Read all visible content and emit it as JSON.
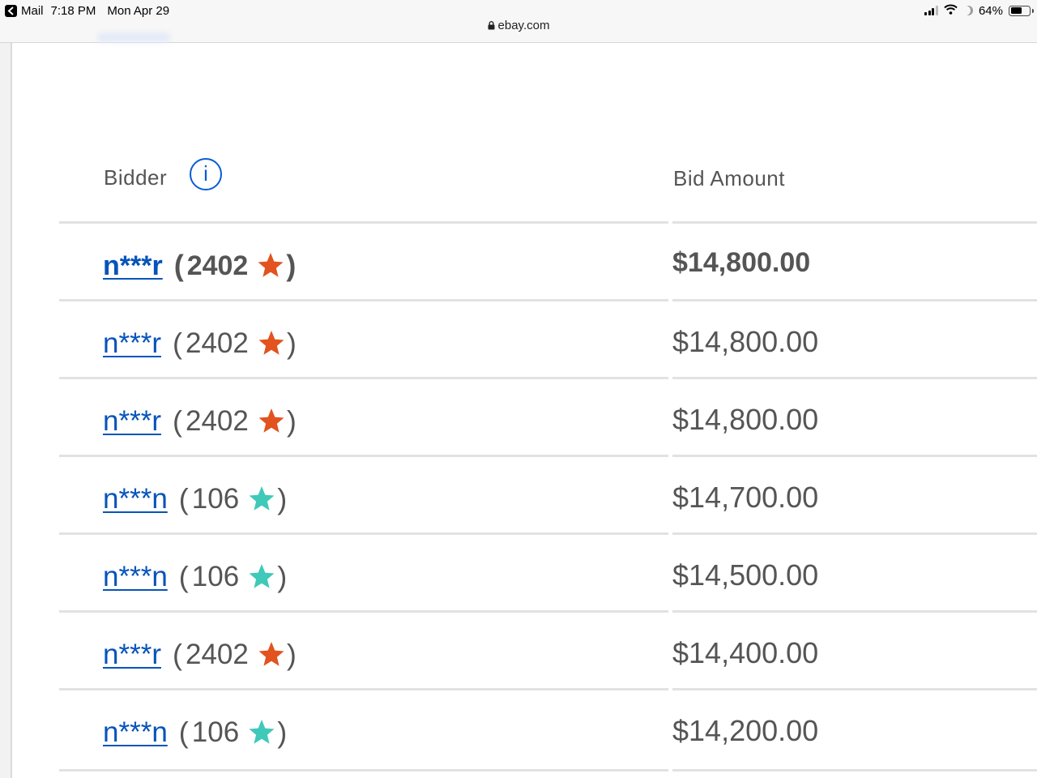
{
  "status_bar": {
    "back_app": "Mail",
    "time": "7:18 PM",
    "date": "Mon Apr 29",
    "battery": "64%",
    "battery_level": 0.64,
    "url": "ebay.com"
  },
  "table": {
    "headers": {
      "bidder": "Bidder",
      "bid_amount": "Bid Amount",
      "info_glyph": "i"
    },
    "rows": [
      {
        "name": "n***r",
        "score": "2402",
        "star_color": "#e2531f",
        "amount": "$14,800.00",
        "highlight": true
      },
      {
        "name": "n***r",
        "score": "2402",
        "star_color": "#e2531f",
        "amount": "$14,800.00",
        "highlight": false
      },
      {
        "name": "n***r",
        "score": "2402",
        "star_color": "#e2531f",
        "amount": "$14,800.00",
        "highlight": false
      },
      {
        "name": "n***n",
        "score": "106",
        "star_color": "#3fc9b8",
        "amount": "$14,700.00",
        "highlight": false
      },
      {
        "name": "n***n",
        "score": "106",
        "star_color": "#3fc9b8",
        "amount": "$14,500.00",
        "highlight": false
      },
      {
        "name": "n***r",
        "score": "2402",
        "star_color": "#e2531f",
        "amount": "$14,400.00",
        "highlight": false
      },
      {
        "name": "n***n",
        "score": "106",
        "star_color": "#3fc9b8",
        "amount": "$14,200.00",
        "highlight": false
      }
    ]
  },
  "theme": {
    "link_color": "#0654ba",
    "info_icon_color": "#0a5bd6",
    "text_color": "#555555"
  }
}
